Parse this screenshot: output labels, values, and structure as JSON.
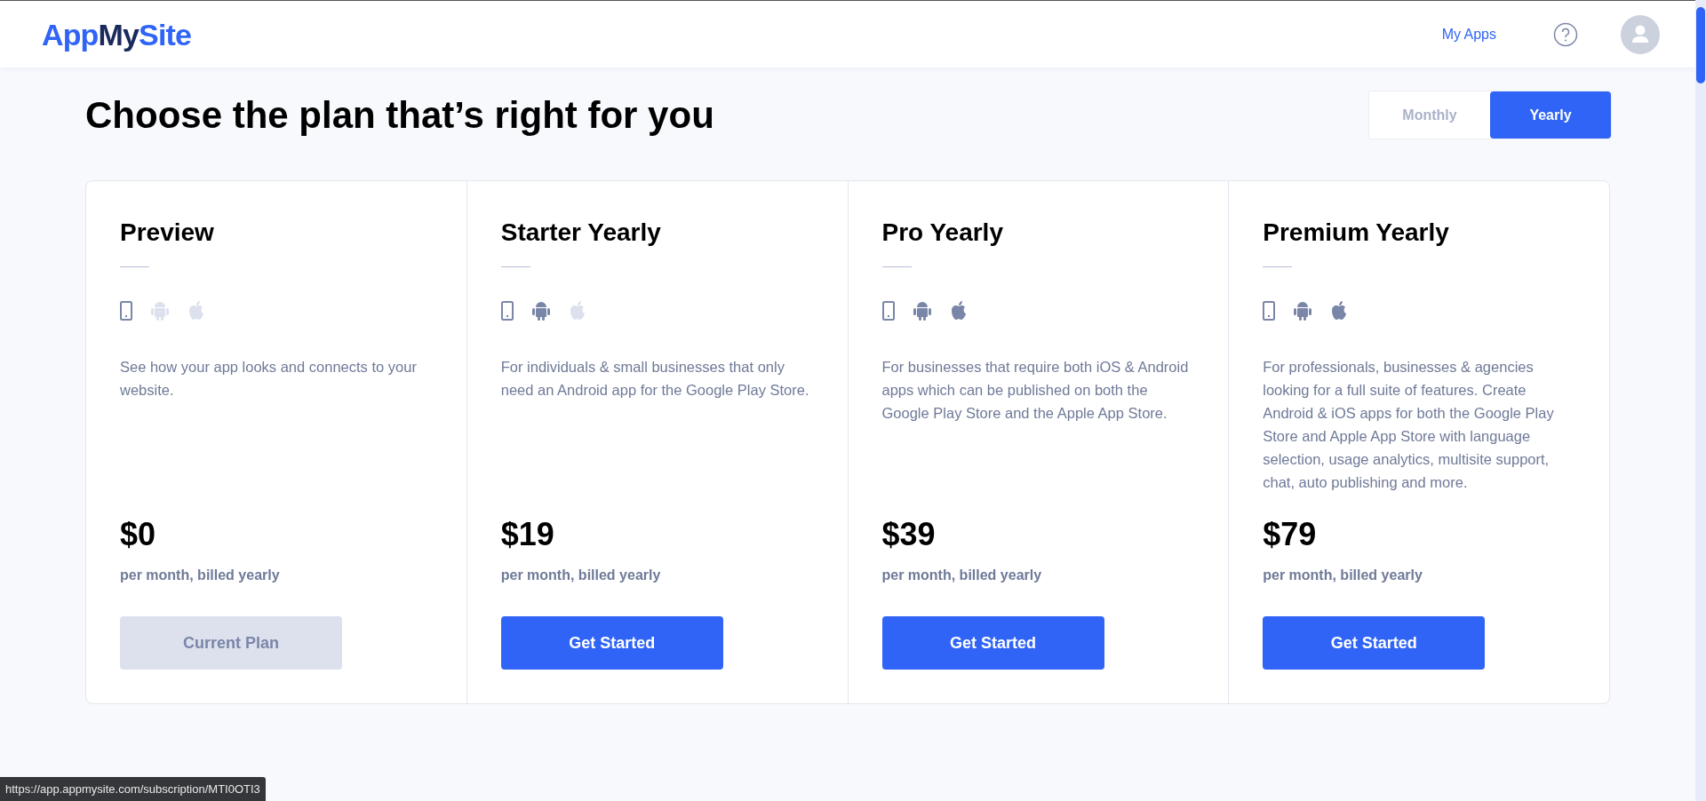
{
  "header": {
    "logo": [
      {
        "text": "App",
        "kind": "accent"
      },
      {
        "text": "My",
        "kind": "dark"
      },
      {
        "text": "Site",
        "kind": "accent"
      }
    ],
    "nav_link": "My Apps"
  },
  "title": "Choose the plan that’s right for you",
  "billing_toggle": [
    {
      "label": "Monthly",
      "selected": false
    },
    {
      "label": "Yearly",
      "selected": true
    }
  ],
  "plans": [
    {
      "name": "Preview",
      "platforms": {
        "web": true,
        "android": false,
        "ios": false
      },
      "description": "See how your app looks and connects to your website.",
      "price": "$0",
      "billing": "per month, billed yearly",
      "button": {
        "label": "Current Plan",
        "disabled": true
      }
    },
    {
      "name": "Starter Yearly",
      "platforms": {
        "web": true,
        "android": true,
        "ios": false
      },
      "description": "For individuals & small businesses that only need an Android app for the Google Play Store.",
      "price": "$19",
      "billing": "per month, billed yearly",
      "button": {
        "label": "Get Started",
        "disabled": false
      }
    },
    {
      "name": "Pro Yearly",
      "platforms": {
        "web": true,
        "android": true,
        "ios": true
      },
      "description": "For businesses that require both iOS & Android apps which can be published on both the Google Play Store and the Apple App Store.",
      "price": "$39",
      "billing": "per month, billed yearly",
      "button": {
        "label": "Get Started",
        "disabled": false
      }
    },
    {
      "name": "Premium Yearly",
      "platforms": {
        "web": true,
        "android": true,
        "ios": true
      },
      "description": "For professionals, businesses & agencies looking for a full suite of features. Create Android & iOS apps for both the Google Play Store and Apple App Store with language selection, usage analytics, multisite support, chat, auto publishing and more.",
      "price": "$79",
      "billing": "per month, billed yearly",
      "button": {
        "label": "Get Started",
        "disabled": false
      }
    }
  ],
  "status_url": "https://app.appmysite.com/subscription/MTI0OTI3"
}
